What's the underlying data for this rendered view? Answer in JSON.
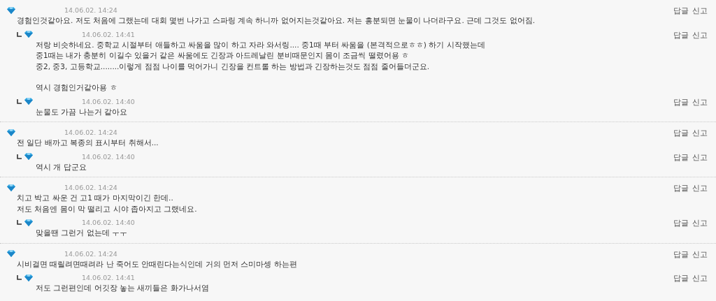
{
  "threads": [
    {
      "time": "14.06.02. 14:24",
      "paragraphs": [
        "경험인것같아요. 저도 처음에 그랬는데 대회 몇번 나가고 스파링 계속 하니까 없어지는것같아요. 저는 흥분되면 눈물이 나더라구요. 근데 그것도 없어짐."
      ],
      "actions": [
        "답글",
        "신고"
      ],
      "replies": [
        {
          "time": "14.06.02. 14:41",
          "paragraphs": [
            "저랑 비슷하네요. 중학교 시절부터 애들하고 싸움을 많이 하고 자라 와서링.... 중1때 부터 싸움을 (본격적으로ㅎㅎ) 하기 시작했는데\n중1때는 내가 충분히 이길수 있을거 같은 싸움에도 긴장과 아드레날린 분비때문인지 몸이 조금씩 떨렸어용 ㅎ\n중2, 중3, 고등학교........이렇게 점점 나이를 먹어가니 긴장을 컨트롤 하는 방법과 긴장하는것도 점점 줄어들더군요.",
            "역시 경험인거같아용 ㅎ"
          ],
          "actions": [
            "답글",
            "신고"
          ]
        },
        {
          "time": "14.06.02. 14:40",
          "paragraphs": [
            "눈물도 가끔 나는거 같아요"
          ],
          "actions": [
            "답글",
            "신고"
          ]
        }
      ]
    },
    {
      "time": "14.06.02. 14:24",
      "paragraphs": [
        "전 일단 배까고 복종의 표시부터 취해서..."
      ],
      "actions": [
        "답글",
        "신고"
      ],
      "replies": [
        {
          "time": "14.06.02. 14:40",
          "paragraphs": [
            "역시 개 답군요"
          ],
          "actions": [
            "답글",
            "신고"
          ]
        }
      ]
    },
    {
      "time": "14.06.02. 14:24",
      "paragraphs": [
        "치고 박고 싸운 건 고1 때가 마지막이긴 한데..\n저도 처음엔 몸이 막 떨리고 시야 좁아지고 그랬네요."
      ],
      "actions": [
        "답글",
        "신고"
      ],
      "replies": [
        {
          "time": "14.06.02. 14:40",
          "paragraphs": [
            "맞을땐 그런거 없는데 ㅜㅜ"
          ],
          "actions": [
            "답글",
            "신고"
          ]
        }
      ]
    },
    {
      "time": "14.06.02. 14:24",
      "paragraphs": [
        "시비걸면 때릴려면때려라 난 죽어도 안때린다는식인데 거의 먼저 스미마셍 하는편"
      ],
      "actions": [
        "답글",
        "신고"
      ],
      "replies": [
        {
          "time": "14.06.02. 14:41",
          "paragraphs": [
            "저도 그런편인데 어깃장 놓는 새끼들은 화가나서염"
          ],
          "actions": [
            "답글",
            "신고"
          ]
        }
      ]
    }
  ]
}
